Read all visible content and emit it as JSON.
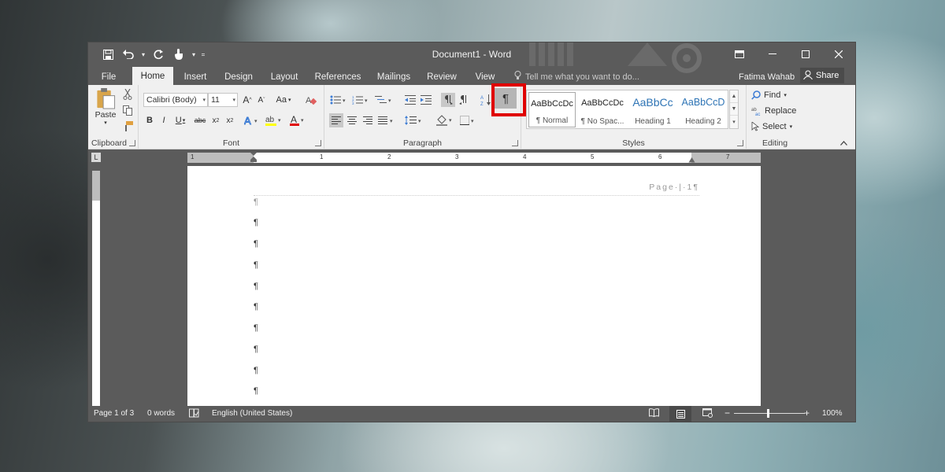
{
  "title_bar": {
    "document_title": "Document1 - Word"
  },
  "tabs": [
    {
      "label": "File",
      "active": false
    },
    {
      "label": "Home",
      "active": true
    },
    {
      "label": "Insert",
      "active": false
    },
    {
      "label": "Design",
      "active": false
    },
    {
      "label": "Layout",
      "active": false
    },
    {
      "label": "References",
      "active": false
    },
    {
      "label": "Mailings",
      "active": false
    },
    {
      "label": "Review",
      "active": false
    },
    {
      "label": "View",
      "active": false
    }
  ],
  "tell_me": {
    "placeholder": "Tell me what you want to do..."
  },
  "user": {
    "name": "Fatima Wahab",
    "share_label": "Share"
  },
  "ribbon": {
    "clipboard": {
      "paste_label": "Paste",
      "group_label": "Clipboard"
    },
    "font": {
      "font_name": "Calibri (Body)",
      "font_size": "11",
      "group_label": "Font",
      "change_case_label": "Aa"
    },
    "paragraph": {
      "group_label": "Paragraph",
      "show_hide_symbol": "¶",
      "show_hide_highlighted": true
    },
    "styles": {
      "group_label": "Styles",
      "items": [
        {
          "preview": "AaBbCcDc",
          "name": "¶ Normal",
          "color": "#222222",
          "selected": true
        },
        {
          "preview": "AaBbCcDc",
          "name": "¶ No Spac...",
          "color": "#222222",
          "selected": false
        },
        {
          "preview": "AaBbCc",
          "name": "Heading 1",
          "color": "#2e74b5",
          "selected": false
        },
        {
          "preview": "AaBbCcD",
          "name": "Heading 2",
          "color": "#2e74b5",
          "selected": false
        }
      ]
    },
    "editing": {
      "group_label": "Editing",
      "find_label": "Find",
      "replace_label": "Replace",
      "select_label": "Select"
    }
  },
  "ruler": {
    "numbers": [
      "1",
      "1",
      "2",
      "3",
      "4",
      "5",
      "6",
      "7"
    ]
  },
  "document": {
    "header_text": "Page·|·1¶",
    "paragraph_marks": [
      "¶",
      "¶",
      "¶",
      "¶",
      "¶",
      "¶",
      "¶",
      "¶",
      "¶",
      "¶"
    ]
  },
  "status_bar": {
    "page_info": "Page 1 of 3",
    "word_count": "0 words",
    "language": "English (United States)",
    "zoom": "100%",
    "zoom_fraction": 0.5
  },
  "colors": {
    "chrome": "#5b5b5b",
    "ribbon": "#f0f0f0",
    "highlight": "#e00000",
    "accent_blue": "#2e74b5"
  }
}
